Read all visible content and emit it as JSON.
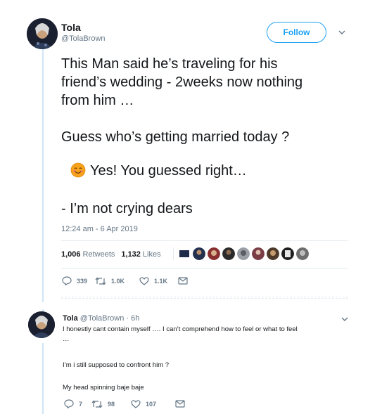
{
  "tweet": {
    "author_name": "Tola",
    "author_handle": "@TolaBrown",
    "follow_label": "Follow",
    "lines": [
      "This Man said he’s traveling for his",
      "friend’s wedding - 2weeks now nothing",
      "from him …",
      "Guess who’s getting married today ?",
      "Yes! You guessed right…",
      "- I’m not crying dears"
    ],
    "timestamp": "12:24 am - 6 Apr 2019",
    "retweets_count": "1,006",
    "retweets_label": "Retweets",
    "likes_count": "1,132",
    "likes_label": "Likes",
    "actions": {
      "reply_count": "339",
      "retweet_count": "1.0K",
      "like_count": "1.1K"
    }
  },
  "reply": {
    "author_name": "Tola",
    "meta": "@TolaBrown · 6h",
    "lines": [
      "I honestly cant contain myself …. I can’t comprehend how to feel or what to feel",
      "…",
      "I’m i still supposed to confront him ?",
      "My head spinning baje baje"
    ],
    "actions": {
      "reply_count": "7",
      "retweet_count": "98",
      "like_count": "107"
    }
  },
  "icons": {
    "reply": "reply-icon",
    "retweet": "retweet-icon",
    "like": "heart-icon",
    "message": "envelope-icon",
    "caret": "chevron-down-icon",
    "emoji": "smiling-face-emoji"
  },
  "colors": {
    "brand": "#1da1f2",
    "secondary_text": "#657786",
    "thread_line": "#cfe6f7"
  }
}
